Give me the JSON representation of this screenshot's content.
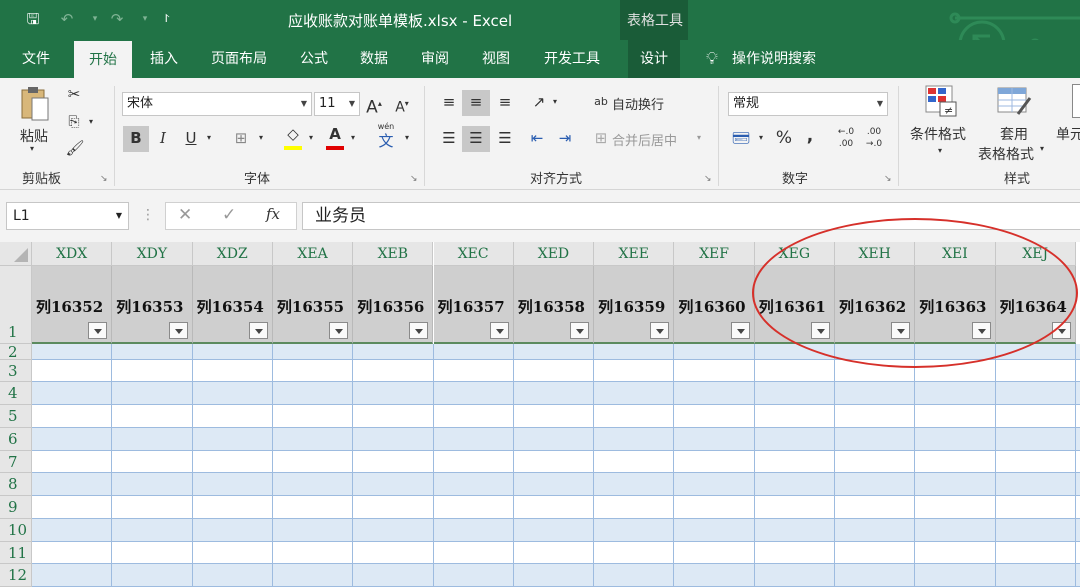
{
  "window": {
    "title": "应收账款对账单模板.xlsx  -  Excel",
    "context_group": "表格工具"
  },
  "qat": {
    "save_icon": "save-icon",
    "undo_icon": "undo-icon",
    "redo_icon": "redo-icon",
    "customize_icon": "customize-qat-icon"
  },
  "tabs": [
    {
      "label": "文件"
    },
    {
      "label": "开始"
    },
    {
      "label": "插入"
    },
    {
      "label": "页面布局"
    },
    {
      "label": "公式"
    },
    {
      "label": "数据"
    },
    {
      "label": "审阅"
    },
    {
      "label": "视图"
    },
    {
      "label": "开发工具"
    },
    {
      "label": "设计"
    }
  ],
  "tell_me": "操作说明搜索",
  "ribbon": {
    "clipboard": {
      "paste": "粘贴",
      "label": "剪贴板"
    },
    "font": {
      "name": "宋体",
      "size": "11",
      "label": "字体",
      "grow": "A",
      "shrink": "A",
      "bold": "B",
      "italic": "I",
      "underline": "U",
      "phonetic_small": "wén",
      "phonetic_big": "文",
      "font_color_letter": "A",
      "font_color": "#e00000",
      "fill_color": "#ffff00"
    },
    "alignment": {
      "wrap": "自动换行",
      "merge": "合并后居中",
      "label": "对齐方式"
    },
    "number": {
      "format": "常规",
      "percent": "%",
      "comma": ",",
      "inc_top": "←.0",
      "inc_bottom": ".00",
      "dec_top": ".00",
      "dec_bottom": "→.0",
      "label": "数字"
    },
    "styles": {
      "conditional": "条件格式",
      "table_line1": "套用",
      "table_line2": "表格格式",
      "cell_partial": "单元",
      "label": "样式"
    }
  },
  "formula_bar": {
    "name_box": "L1",
    "content": "业务员",
    "fx": "fx"
  },
  "columns": [
    "XDX",
    "XDY",
    "XDZ",
    "XEA",
    "XEB",
    "XEC",
    "XED",
    "XEE",
    "XEF",
    "XEG",
    "XEH",
    "XEI",
    "XEJ"
  ],
  "header_cells": [
    "列16352",
    "列16353",
    "列16354",
    "列16355",
    "列16356",
    "列16357",
    "列16358",
    "列16359",
    "列16360",
    "列16361",
    "列16362",
    "列16363",
    "列16364"
  ],
  "rows": [
    "1",
    "2",
    "3",
    "4",
    "5",
    "6",
    "7",
    "8",
    "9",
    "10",
    "11",
    "12"
  ],
  "colors": {
    "excel_green": "#217346",
    "band": "#dde9f5",
    "annotation": "#d6302a"
  }
}
